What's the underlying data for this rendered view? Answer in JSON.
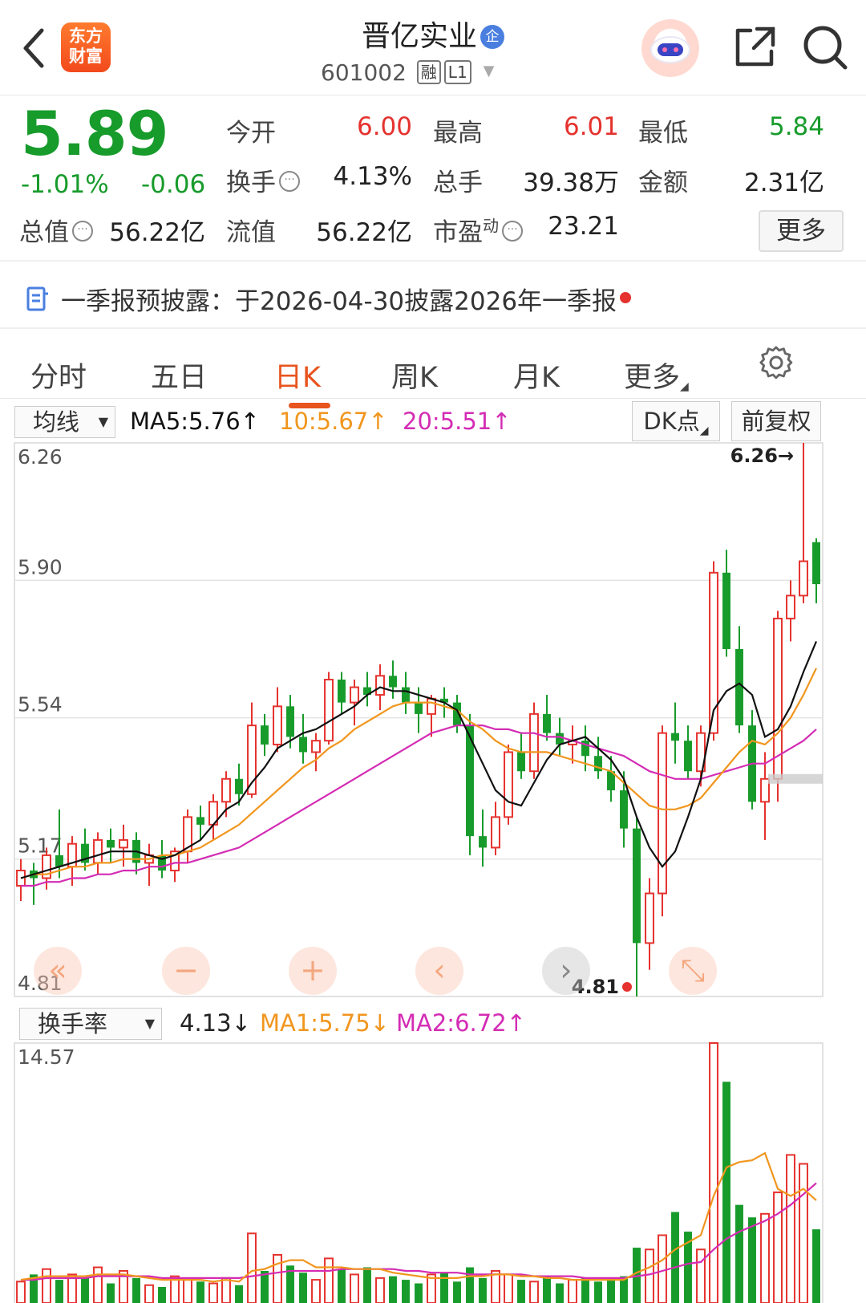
{
  "header": {
    "logo_line1": "东方",
    "logo_line2": "财富",
    "stock_name": "晋亿实业",
    "badge": "企",
    "code": "601002",
    "tag_margin": "融",
    "tag_level": "L1"
  },
  "quote": {
    "price": "5.89",
    "change_pct": "-1.01%",
    "change_abs": "-0.06",
    "fields": [
      {
        "label": "今开",
        "value": "6.00",
        "color": "#e5322e"
      },
      {
        "label": "最高",
        "value": "6.01",
        "color": "#e5322e"
      },
      {
        "label": "最低",
        "value": "5.84",
        "color": "#179b2b"
      },
      {
        "label": "换手",
        "value": "4.13%",
        "color": "#222222"
      },
      {
        "label": "总手",
        "value": "39.38万",
        "color": "#222222"
      },
      {
        "label": "金额",
        "value": "2.31亿",
        "color": "#222222"
      },
      {
        "label": "总值",
        "value": "56.22亿",
        "color": "#222222"
      },
      {
        "label": "流值",
        "value": "56.22亿",
        "color": "#222222"
      },
      {
        "label": "市盈",
        "sup": "动",
        "value": "23.21",
        "color": "#222222"
      }
    ],
    "more_label": "更多"
  },
  "notice": {
    "text": "一季报预披露：于2026-04-30披露2026年一季报"
  },
  "tabs": [
    {
      "label": "分时",
      "active": false
    },
    {
      "label": "五日",
      "active": false
    },
    {
      "label": "日K",
      "active": true
    },
    {
      "label": "周K",
      "active": false
    },
    {
      "label": "月K",
      "active": false
    },
    {
      "label": "更多",
      "active": false
    }
  ],
  "kline": {
    "indicator_select": "均线",
    "ma5_label": "MA5:5.76↑",
    "ma10_label": "10:5.67↑",
    "ma20_label": "20:5.51↑",
    "dk_button": "DK点",
    "adjust_button": "前复权",
    "max_marker": "6.26→",
    "min_marker": "4.81"
  },
  "volume": {
    "indicator_select": "换手率",
    "value_label": "4.13↓",
    "ma1_label": "MA1:5.75↓",
    "ma2_label": "MA2:6.72↑"
  },
  "colors": {
    "up": "#e5322e",
    "down": "#179b2b",
    "ma5": "#111111",
    "ma10": "#f1961e",
    "ma20": "#d42cb4",
    "accent": "#e8541e"
  },
  "chart_data": [
    {
      "type": "candlestick",
      "title": "",
      "y_ticks": [
        "6.26",
        "5.90",
        "5.54",
        "5.17",
        "4.81"
      ],
      "ylim": [
        4.81,
        6.26
      ],
      "ohlc": [
        [
          5.1,
          5.17,
          5.06,
          5.14
        ],
        [
          5.14,
          5.16,
          5.05,
          5.12
        ],
        [
          5.12,
          5.2,
          5.09,
          5.18
        ],
        [
          5.18,
          5.3,
          5.12,
          5.15
        ],
        [
          5.15,
          5.23,
          5.1,
          5.21
        ],
        [
          5.21,
          5.25,
          5.14,
          5.16
        ],
        [
          5.16,
          5.24,
          5.13,
          5.22
        ],
        [
          5.22,
          5.25,
          5.16,
          5.2
        ],
        [
          5.2,
          5.26,
          5.15,
          5.22
        ],
        [
          5.22,
          5.24,
          5.13,
          5.16
        ],
        [
          5.16,
          5.21,
          5.1,
          5.18
        ],
        [
          5.18,
          5.22,
          5.12,
          5.14
        ],
        [
          5.14,
          5.2,
          5.11,
          5.19
        ],
        [
          5.19,
          5.3,
          5.16,
          5.28
        ],
        [
          5.28,
          5.31,
          5.22,
          5.26
        ],
        [
          5.26,
          5.34,
          5.22,
          5.32
        ],
        [
          5.32,
          5.4,
          5.28,
          5.38
        ],
        [
          5.38,
          5.42,
          5.31,
          5.34
        ],
        [
          5.34,
          5.58,
          5.33,
          5.52
        ],
        [
          5.52,
          5.55,
          5.44,
          5.47
        ],
        [
          5.47,
          5.62,
          5.45,
          5.57
        ],
        [
          5.57,
          5.6,
          5.46,
          5.49
        ],
        [
          5.49,
          5.55,
          5.42,
          5.45
        ],
        [
          5.45,
          5.5,
          5.4,
          5.48
        ],
        [
          5.48,
          5.66,
          5.47,
          5.64
        ],
        [
          5.64,
          5.66,
          5.55,
          5.58
        ],
        [
          5.58,
          5.64,
          5.52,
          5.62
        ],
        [
          5.62,
          5.66,
          5.57,
          5.6
        ],
        [
          5.6,
          5.68,
          5.56,
          5.65
        ],
        [
          5.65,
          5.69,
          5.59,
          5.62
        ],
        [
          5.62,
          5.66,
          5.55,
          5.58
        ],
        [
          5.58,
          5.62,
          5.5,
          5.55
        ],
        [
          5.55,
          5.6,
          5.49,
          5.59
        ],
        [
          5.59,
          5.62,
          5.54,
          5.58
        ],
        [
          5.58,
          5.6,
          5.5,
          5.52
        ],
        [
          5.52,
          5.55,
          5.18,
          5.23
        ],
        [
          5.23,
          5.3,
          5.15,
          5.2
        ],
        [
          5.2,
          5.32,
          5.18,
          5.28
        ],
        [
          5.28,
          5.47,
          5.26,
          5.45
        ],
        [
          5.45,
          5.5,
          5.38,
          5.4
        ],
        [
          5.4,
          5.58,
          5.38,
          5.55
        ],
        [
          5.55,
          5.6,
          5.48,
          5.5
        ],
        [
          5.5,
          5.54,
          5.44,
          5.47
        ],
        [
          5.47,
          5.52,
          5.42,
          5.48
        ],
        [
          5.48,
          5.52,
          5.4,
          5.44
        ],
        [
          5.44,
          5.49,
          5.38,
          5.4
        ],
        [
          5.4,
          5.44,
          5.32,
          5.35
        ],
        [
          5.35,
          5.4,
          5.2,
          5.25
        ],
        [
          5.25,
          5.28,
          4.81,
          4.95
        ],
        [
          4.95,
          5.12,
          4.88,
          5.08
        ],
        [
          5.08,
          5.52,
          5.02,
          5.5
        ],
        [
          5.5,
          5.58,
          5.42,
          5.48
        ],
        [
          5.48,
          5.52,
          5.38,
          5.4
        ],
        [
          5.4,
          5.52,
          5.36,
          5.5
        ],
        [
          5.5,
          5.95,
          5.48,
          5.92
        ],
        [
          5.92,
          5.98,
          5.7,
          5.72
        ],
        [
          5.72,
          5.78,
          5.5,
          5.52
        ],
        [
          5.52,
          5.56,
          5.3,
          5.32
        ],
        [
          5.32,
          5.45,
          5.22,
          5.38
        ],
        [
          5.38,
          5.82,
          5.32,
          5.8
        ],
        [
          5.8,
          5.9,
          5.74,
          5.86
        ],
        [
          5.86,
          6.26,
          5.84,
          5.95
        ],
        [
          6.0,
          6.01,
          5.84,
          5.89
        ]
      ],
      "ma5": [
        5.12,
        5.13,
        5.14,
        5.15,
        5.16,
        5.17,
        5.18,
        5.19,
        5.19,
        5.19,
        5.18,
        5.17,
        5.18,
        5.2,
        5.22,
        5.26,
        5.3,
        5.32,
        5.37,
        5.41,
        5.46,
        5.48,
        5.5,
        5.51,
        5.53,
        5.55,
        5.57,
        5.6,
        5.62,
        5.61,
        5.61,
        5.6,
        5.59,
        5.58,
        5.56,
        5.49,
        5.42,
        5.35,
        5.32,
        5.31,
        5.37,
        5.43,
        5.47,
        5.48,
        5.49,
        5.46,
        5.43,
        5.38,
        5.28,
        5.2,
        5.15,
        5.19,
        5.28,
        5.38,
        5.56,
        5.61,
        5.63,
        5.6,
        5.49,
        5.51,
        5.57,
        5.66,
        5.74
      ],
      "ma10": [
        5.12,
        5.13,
        5.13,
        5.14,
        5.15,
        5.15,
        5.16,
        5.16,
        5.17,
        5.17,
        5.17,
        5.18,
        5.18,
        5.19,
        5.2,
        5.22,
        5.24,
        5.26,
        5.29,
        5.32,
        5.35,
        5.38,
        5.41,
        5.43,
        5.46,
        5.48,
        5.51,
        5.53,
        5.55,
        5.57,
        5.58,
        5.58,
        5.58,
        5.57,
        5.56,
        5.53,
        5.51,
        5.48,
        5.46,
        5.45,
        5.45,
        5.45,
        5.44,
        5.43,
        5.42,
        5.41,
        5.4,
        5.37,
        5.34,
        5.31,
        5.3,
        5.3,
        5.31,
        5.33,
        5.37,
        5.41,
        5.45,
        5.48,
        5.47,
        5.5,
        5.54,
        5.6,
        5.67
      ],
      "ma20": [
        5.1,
        5.1,
        5.11,
        5.11,
        5.12,
        5.12,
        5.13,
        5.13,
        5.14,
        5.14,
        5.15,
        5.15,
        5.16,
        5.16,
        5.17,
        5.18,
        5.19,
        5.2,
        5.22,
        5.24,
        5.26,
        5.28,
        5.3,
        5.32,
        5.34,
        5.36,
        5.38,
        5.4,
        5.42,
        5.44,
        5.46,
        5.48,
        5.5,
        5.51,
        5.52,
        5.52,
        5.52,
        5.51,
        5.51,
        5.5,
        5.5,
        5.49,
        5.49,
        5.48,
        5.47,
        5.46,
        5.45,
        5.44,
        5.42,
        5.4,
        5.39,
        5.38,
        5.38,
        5.38,
        5.39,
        5.4,
        5.41,
        5.42,
        5.42,
        5.44,
        5.46,
        5.48,
        5.51
      ]
    },
    {
      "type": "bar",
      "title": "",
      "y_ticks": [
        "14.57"
      ],
      "ylim": [
        0,
        14.57
      ],
      "values": [
        1.2,
        1.6,
        1.9,
        1.3,
        1.6,
        1.4,
        2.0,
        1.1,
        1.8,
        1.4,
        1.0,
        0.9,
        1.5,
        1.3,
        1.2,
        1.1,
        1.4,
        1.0,
        3.9,
        1.8,
        2.7,
        2.1,
        1.7,
        1.3,
        2.5,
        1.9,
        1.6,
        2.0,
        1.4,
        1.5,
        1.3,
        1.1,
        1.6,
        1.7,
        1.2,
        2.0,
        1.4,
        1.8,
        1.6,
        1.3,
        1.2,
        1.5,
        1.1,
        1.3,
        1.4,
        1.2,
        1.3,
        1.5,
        3.1,
        3.0,
        3.8,
        5.1,
        4.0,
        3.0,
        14.57,
        12.4,
        5.5,
        4.8,
        5.0,
        6.2,
        8.3,
        7.8,
        4.13
      ],
      "ma1": [
        1.3,
        1.4,
        1.5,
        1.5,
        1.5,
        1.5,
        1.6,
        1.6,
        1.6,
        1.5,
        1.4,
        1.3,
        1.3,
        1.3,
        1.3,
        1.2,
        1.3,
        1.2,
        1.8,
        1.9,
        2.2,
        2.4,
        2.4,
        2.0,
        2.0,
        2.0,
        1.9,
        1.9,
        1.9,
        1.7,
        1.6,
        1.5,
        1.4,
        1.4,
        1.4,
        1.5,
        1.5,
        1.6,
        1.6,
        1.5,
        1.5,
        1.4,
        1.4,
        1.3,
        1.3,
        1.3,
        1.3,
        1.3,
        1.7,
        2.0,
        2.4,
        3.0,
        3.4,
        3.8,
        6.0,
        7.6,
        7.9,
        8.0,
        8.4,
        6.4,
        6.0,
        6.4,
        5.75
      ],
      "ma2": [
        1.3,
        1.3,
        1.4,
        1.4,
        1.4,
        1.4,
        1.5,
        1.5,
        1.5,
        1.5,
        1.5,
        1.4,
        1.4,
        1.4,
        1.4,
        1.4,
        1.4,
        1.4,
        1.5,
        1.6,
        1.7,
        1.8,
        1.8,
        1.8,
        1.8,
        1.9,
        1.9,
        1.9,
        1.9,
        1.9,
        1.8,
        1.8,
        1.7,
        1.7,
        1.7,
        1.6,
        1.6,
        1.6,
        1.6,
        1.6,
        1.5,
        1.5,
        1.5,
        1.5,
        1.4,
        1.4,
        1.4,
        1.4,
        1.5,
        1.6,
        1.8,
        2.0,
        2.2,
        2.3,
        3.0,
        3.6,
        4.0,
        4.3,
        4.6,
        5.0,
        5.5,
        6.1,
        6.72
      ]
    }
  ]
}
